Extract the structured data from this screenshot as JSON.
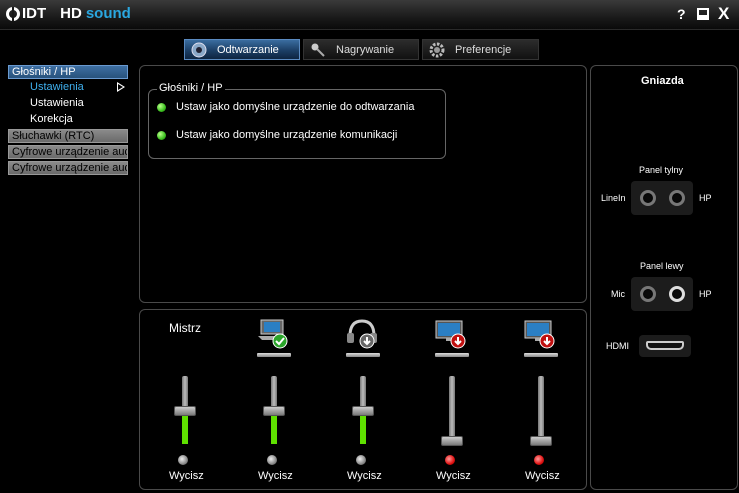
{
  "app": {
    "brand_idt": "IDT",
    "brand_hd": "HD",
    "brand_sound": "sound"
  },
  "window": {
    "help": "?",
    "close": "X"
  },
  "tabs": [
    {
      "label": "Odtwarzanie",
      "icon": "speaker-icon"
    },
    {
      "label": "Nagrywanie",
      "icon": "microphone-icon"
    },
    {
      "label": "Preferencje",
      "icon": "gear-icon"
    }
  ],
  "sidebar": {
    "device1": "Głośniki / HP",
    "sub_ustawienia_active": "Ustawienia",
    "sub_ustawienia": "Ustawienia",
    "sub_korekcja": "Korekcja",
    "device2": "Słuchawki (RTC)",
    "device3": "Cyfrowe urządzenie audio",
    "device4": "Cyfrowe urządzenie audio"
  },
  "main": {
    "group_title": "Głośniki / HP",
    "opt1": "Ustaw jako domyślne urządzenie do odtwarzania",
    "opt2": "Ustaw jako domyślne urządzenie komunikacji"
  },
  "mixer": {
    "master_label": "Mistrz",
    "channels": [
      {
        "name": "master",
        "level": 0.48,
        "muted": false,
        "mute_label": "Wycisz"
      },
      {
        "name": "laptop-speakers",
        "level": 0.48,
        "muted": false,
        "mute_label": "Wycisz"
      },
      {
        "name": "headphones",
        "level": 0.48,
        "muted": false,
        "mute_label": "Wycisz"
      },
      {
        "name": "monitor-1",
        "level": 0.0,
        "muted": true,
        "mute_label": "Wycisz"
      },
      {
        "name": "monitor-2",
        "level": 0.0,
        "muted": true,
        "mute_label": "Wycisz"
      }
    ]
  },
  "jacks": {
    "title": "Gniazda",
    "rear_panel": "Panel tylny",
    "rear_left": "LineIn",
    "rear_right": "HP",
    "left_panel": "Panel lewy",
    "left_left": "Mic",
    "left_right": "HP",
    "hdmi": "HDMI"
  },
  "colors": {
    "accent": "#2aa7e0",
    "level": "#5fe000",
    "mute_on": "#e01010",
    "ok": "#3bbf1f"
  }
}
